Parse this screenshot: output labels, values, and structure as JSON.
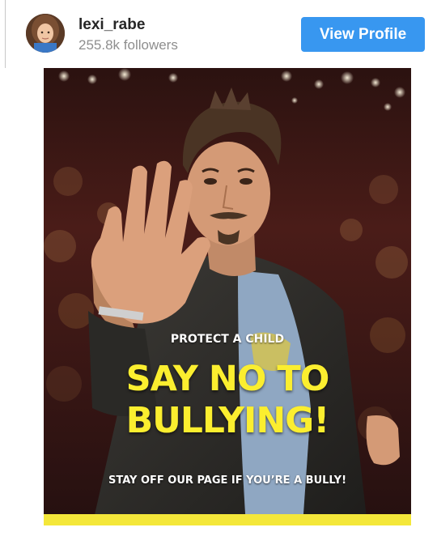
{
  "profile": {
    "username": "lexi_rabe",
    "followers": "255.8k followers",
    "view_profile_label": "View Profile"
  },
  "post": {
    "kicker": "PROTECT A CHILD",
    "headline_line1": "SAY NO TO",
    "headline_line2": "BULLYING!",
    "footer": "STAY OFF OUR PAGE IF YOU’RE A BULLY!"
  },
  "colors": {
    "button": "#3897f0",
    "headline": "#fbee2f",
    "bottom_bar": "#f4e73a",
    "username": "#262626",
    "followers": "#8e8e8e"
  }
}
